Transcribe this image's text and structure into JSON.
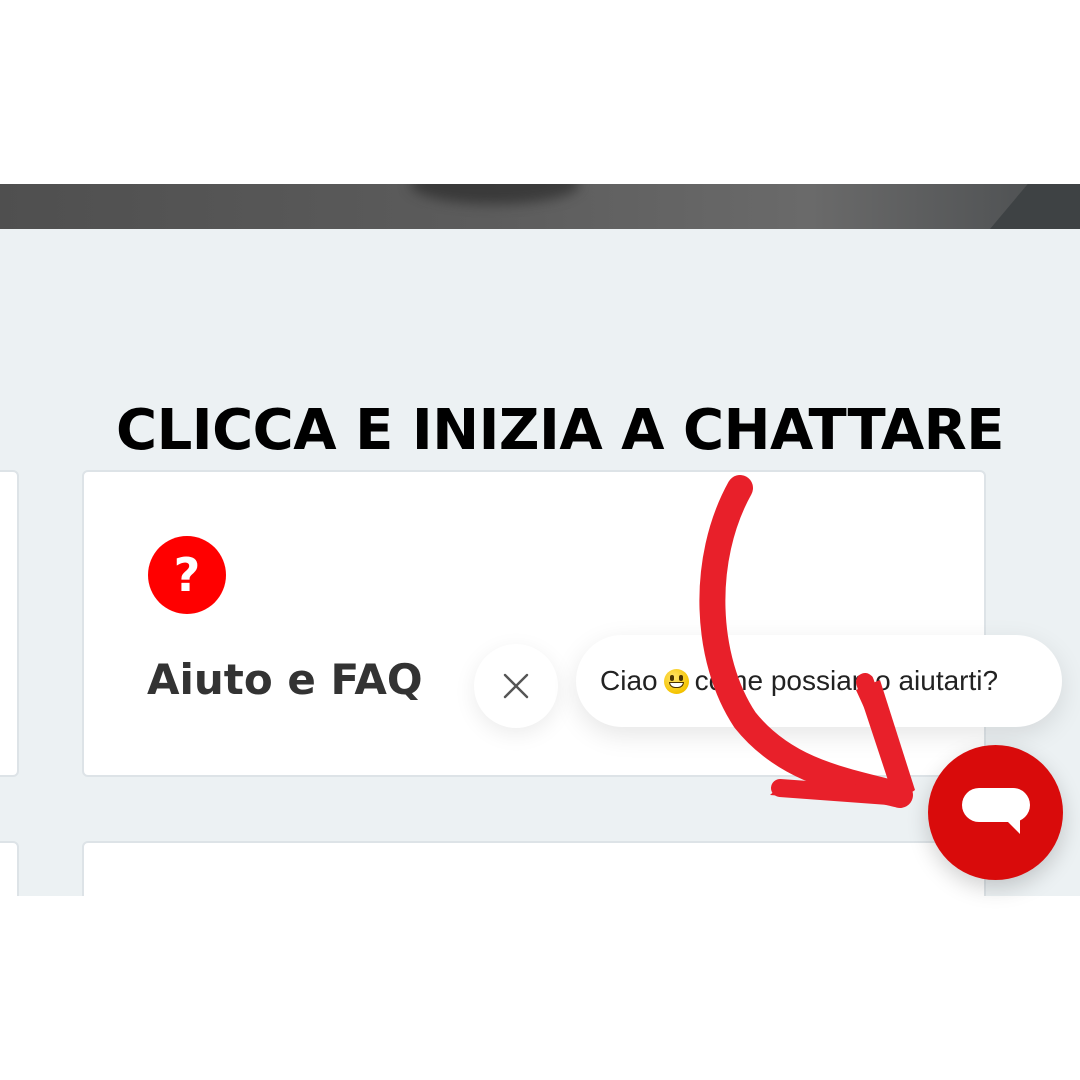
{
  "overlay": {
    "headline": "CLICCA E INIZIA A CHATTARE"
  },
  "faq_card": {
    "icon": "question-mark-icon",
    "icon_glyph": "?",
    "title": "Aiuto e FAQ"
  },
  "chat_widget": {
    "greeting_before": "Ciao",
    "greeting_emoji": "grinning-face-emoji",
    "greeting_after": "come possiamo aiutarti?",
    "close_icon": "close-icon",
    "launcher_icon": "chat-bubble-icon"
  },
  "colors": {
    "brand_red": "#ff0000",
    "launcher_red": "#d90b0b",
    "arrow_red": "#e8202a",
    "page_background": "#ecf1f3"
  }
}
